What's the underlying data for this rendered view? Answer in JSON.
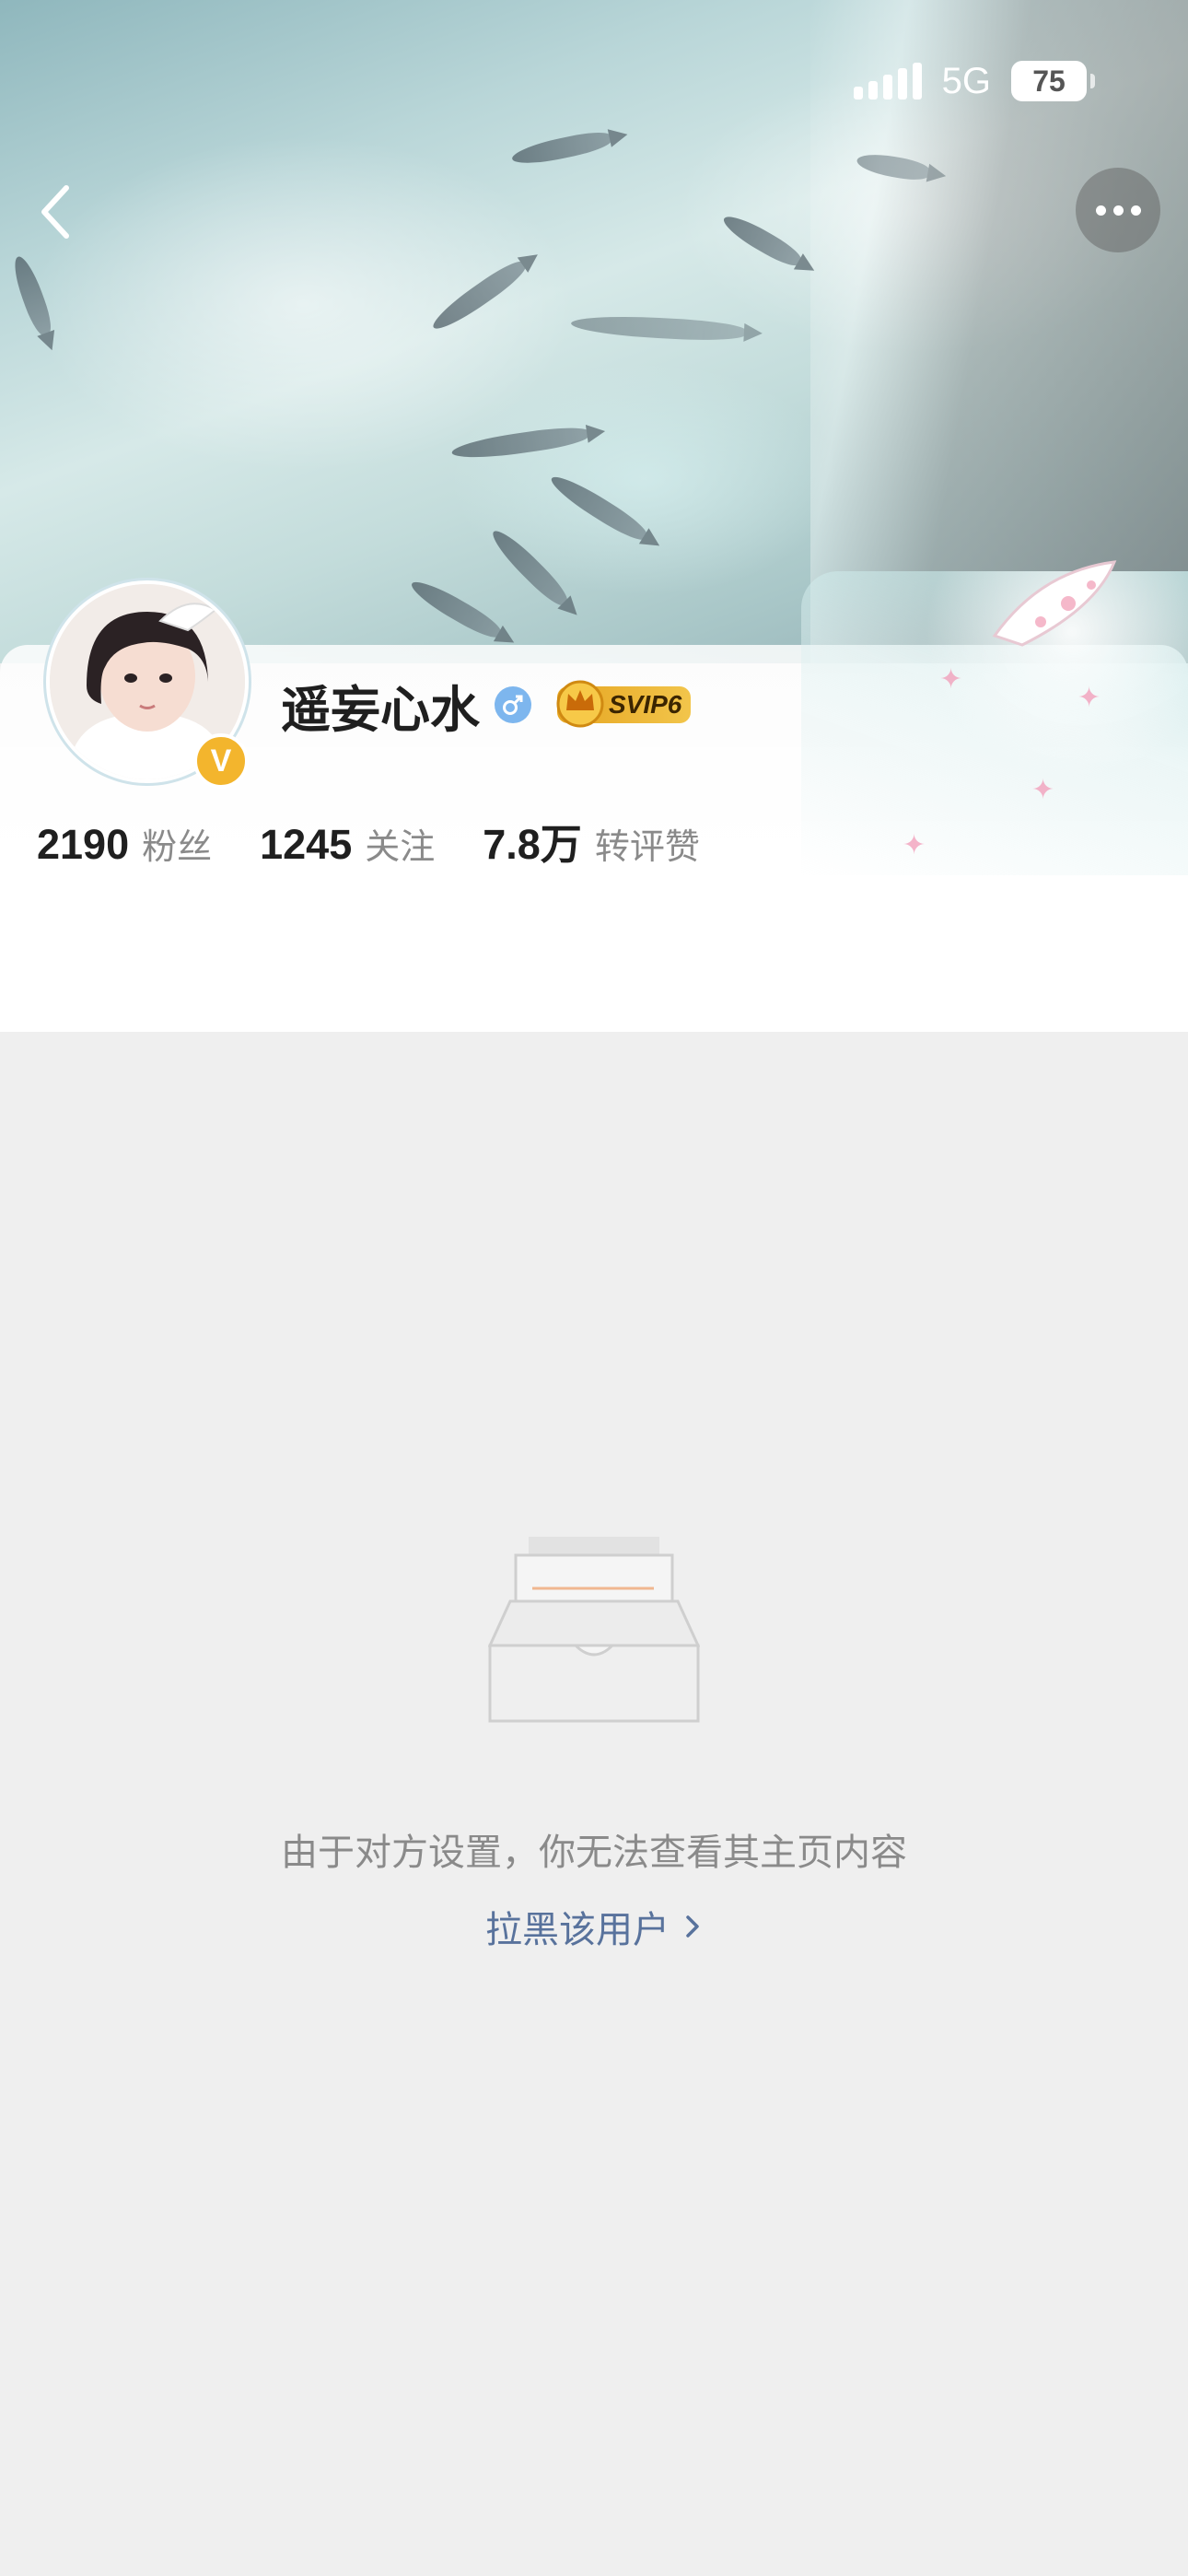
{
  "status_bar": {
    "network": "5G",
    "battery": "75"
  },
  "header": {
    "back_icon": "chevron-left-icon",
    "more_icon": "more-horizontal-icon"
  },
  "profile": {
    "username": "遥妄心水",
    "gender_icon": "male-icon",
    "verified_badge": "V",
    "vip_badge": "SVIP6",
    "stats": [
      {
        "value": "2190",
        "label": "粉丝"
      },
      {
        "value": "1245",
        "label": "关注"
      },
      {
        "value": "7.8万",
        "label": "转评赞"
      }
    ]
  },
  "empty_state": {
    "illustration_icon": "empty-inbox-icon",
    "message": "由于对方设置，你无法查看其主页内容",
    "action_label": "拉黑该用户",
    "action_icon": "chevron-right-icon"
  },
  "colors": {
    "link": "#58729c",
    "muted_text": "#8a8a8a",
    "page_background": "#efefef",
    "verified": "#f3b52d",
    "gender": "#7db6ee"
  }
}
